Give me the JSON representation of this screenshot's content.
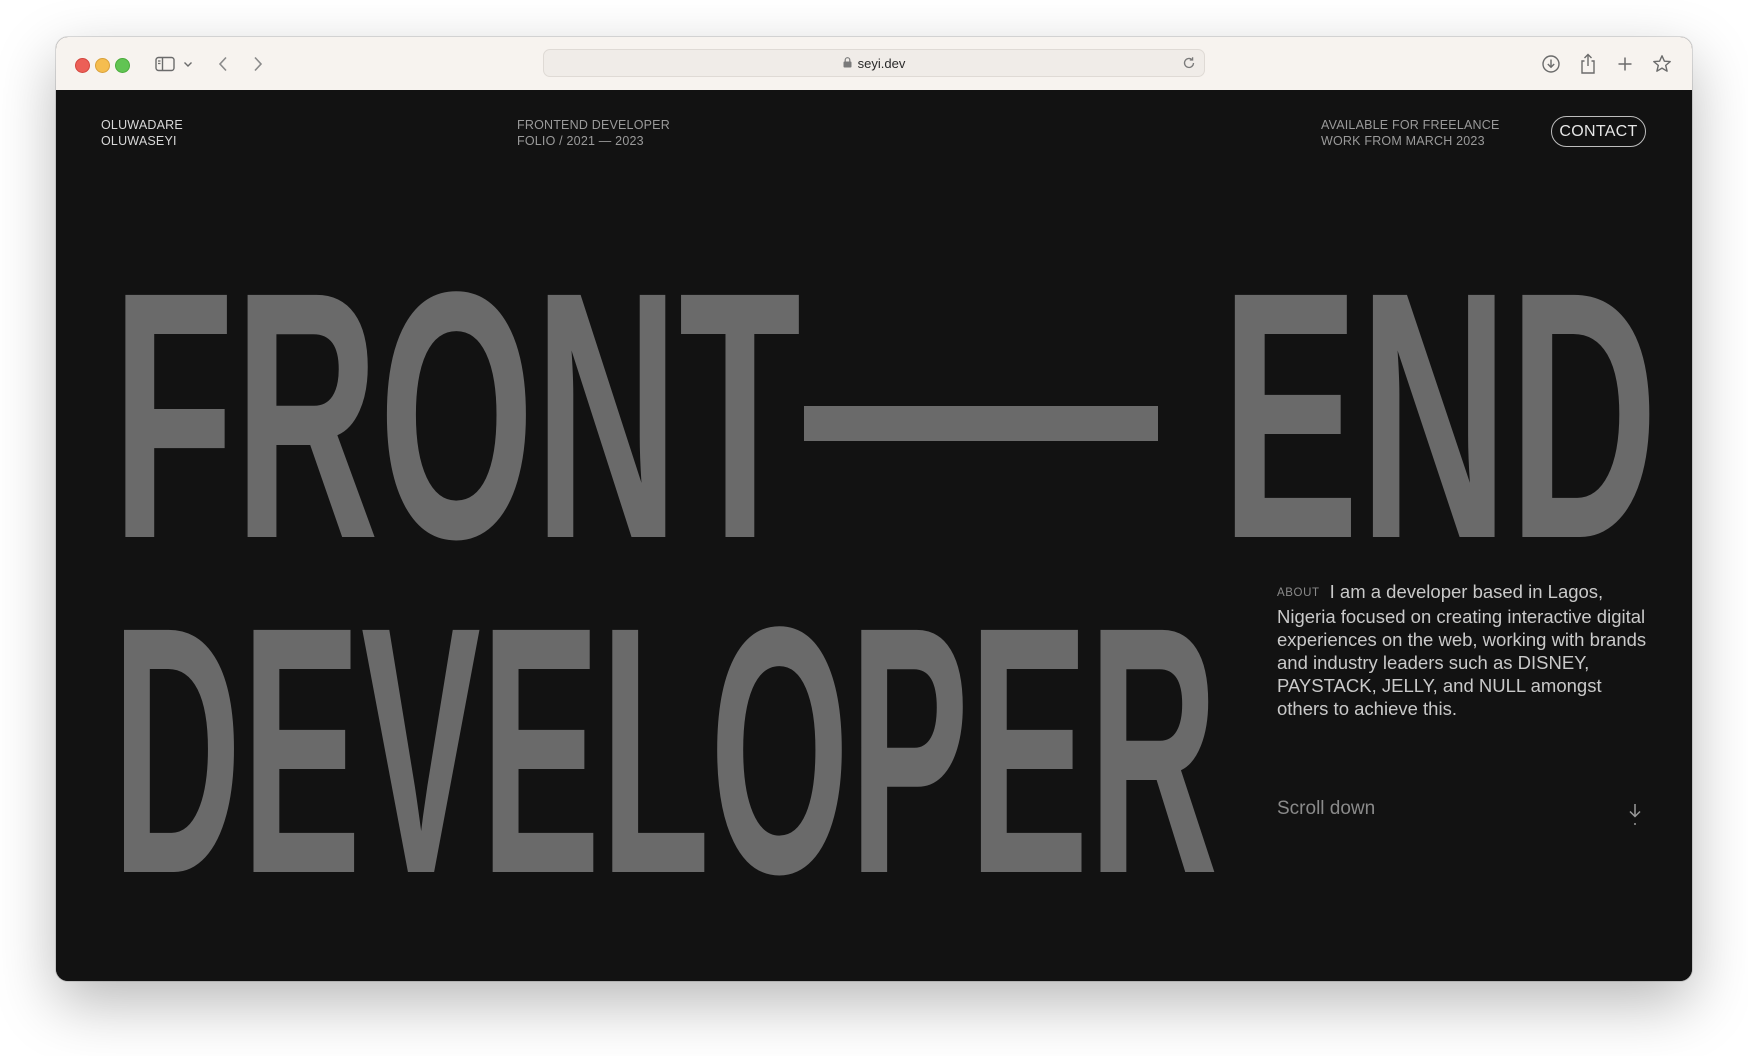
{
  "browser": {
    "url": "seyi.dev",
    "icons": {
      "sidebar": "sidebar-toggle-icon",
      "chevron": "chevron-down-icon",
      "back": "back-arrow-icon",
      "forward": "forward-arrow-icon",
      "lock": "lock-icon",
      "reload": "reload-icon",
      "download": "download-icon",
      "share": "share-icon",
      "new_tab": "plus-icon",
      "bookmark": "star-icon"
    }
  },
  "header": {
    "name_line1": "OLUWADARE",
    "name_line2": "OLUWASEYI",
    "role_line1": "FRONTEND DEVELOPER",
    "role_line2": "FOLIO / 2021 — 2023",
    "availability_line1": "AVAILABLE FOR FREELANCE",
    "availability_line2": "WORK FROM MARCH 2023",
    "contact_label": "CONTACT"
  },
  "hero": {
    "word1": "FRONT",
    "word2": "END",
    "word3": "DEVELOPER"
  },
  "about": {
    "label": "ABOUT",
    "text": "I am a developer based in Lagos, Nigeria focused on creating interactive digital experiences on the web, working with brands and industry leaders such as DISNEY, PAYSTACK, JELLY, and NULL amongst others to achieve this."
  },
  "scroll": {
    "label": "Scroll down",
    "icon": "arrow-down-icon"
  },
  "colors": {
    "background": "#121212",
    "hero_text": "#6a6a6a",
    "toolbar": "#f7f3ef"
  }
}
